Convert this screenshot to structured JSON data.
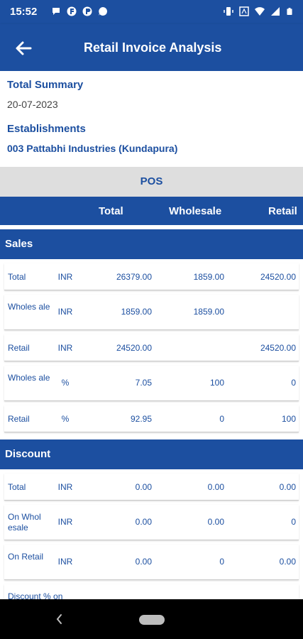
{
  "status": {
    "time": "15:52",
    "left_icons": [
      "chat-bubble-icon",
      "flipkart-icon",
      "flipkart-icon",
      "chat-icon"
    ],
    "right_icons": [
      "vibrate-icon",
      "data-saver-icon",
      "wifi-icon",
      "signal-icon",
      "battery-icon"
    ]
  },
  "appbar": {
    "title": "Retail Invoice Analysis",
    "back_icon": "arrow-left-icon"
  },
  "summary": {
    "total_summary_label": "Total Summary",
    "date": "20-07-2023",
    "establishments_label": "Establishments",
    "establishment": "003 Pattabhi Industries (Kundapura)"
  },
  "pos_label": "POS",
  "columns": {
    "total": "Total",
    "wholesale": "Wholesale",
    "retail": "Retail"
  },
  "sections": [
    {
      "title": "Sales",
      "rows": [
        {
          "label": "Total",
          "unit": "INR",
          "total": "26379.00",
          "wholesale": "1859.00",
          "retail": "24520.00"
        },
        {
          "label": "Wholes ale",
          "unit": "INR",
          "total": "1859.00",
          "wholesale": "1859.00",
          "retail": ""
        },
        {
          "label": "Retail",
          "unit": "INR",
          "total": "24520.00",
          "wholesale": "",
          "retail": "24520.00"
        },
        {
          "label": "Wholes ale",
          "unit": "%",
          "total": "7.05",
          "wholesale": "100",
          "retail": "0"
        },
        {
          "label": "Retail",
          "unit": "%",
          "total": "92.95",
          "wholesale": "0",
          "retail": "100"
        }
      ]
    },
    {
      "title": "Discount",
      "rows": [
        {
          "label": "Total",
          "unit": "INR",
          "total": "0.00",
          "wholesale": "0.00",
          "retail": "0.00"
        },
        {
          "label": "On Whol esale",
          "unit": "INR",
          "total": "0.00",
          "wholesale": "0.00",
          "retail": "0"
        },
        {
          "label": "On Retail",
          "unit": "INR",
          "total": "0.00",
          "wholesale": "0",
          "retail": "0.00"
        },
        {
          "label": "Discount % on",
          "unit": "",
          "total": "",
          "wholesale": "",
          "retail": ""
        }
      ]
    }
  ],
  "colors": {
    "primary": "#1c4fa0",
    "pos_bar": "#dedede",
    "navbar": "#000000"
  },
  "navbar_icons": [
    "nav-back-icon",
    "nav-home-icon"
  ]
}
